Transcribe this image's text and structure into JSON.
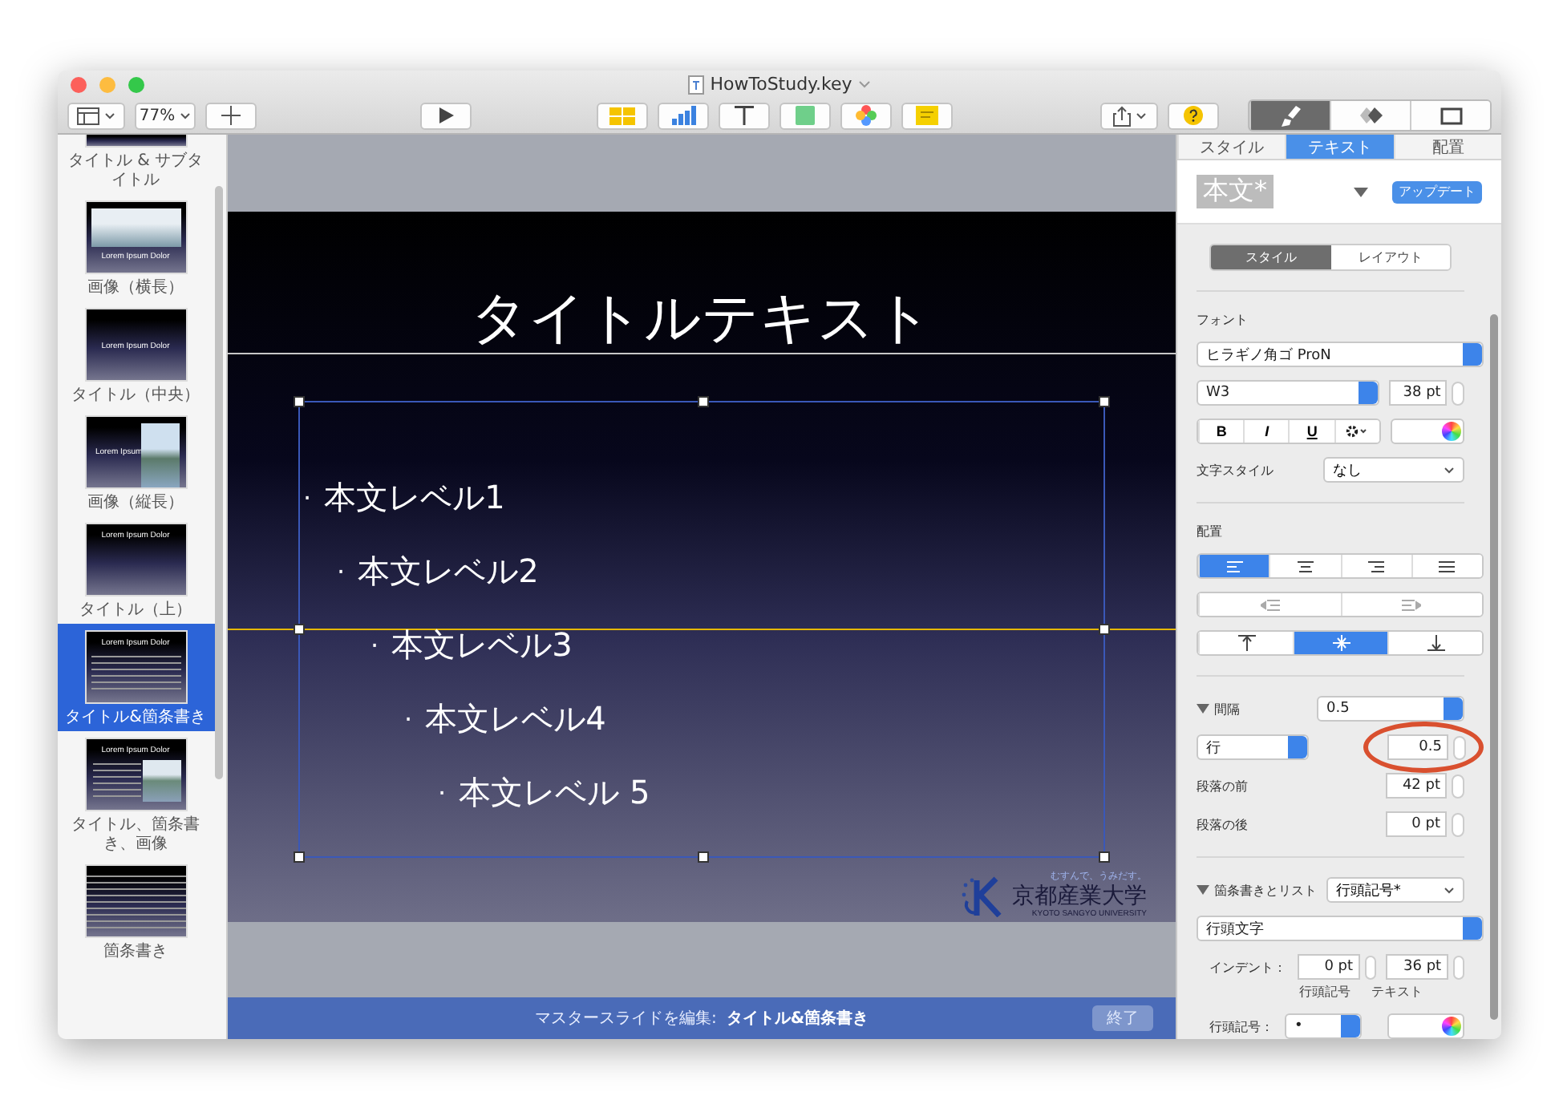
{
  "window": {
    "title": "HowToStudy.key"
  },
  "toolbar": {
    "zoom": "77%"
  },
  "slides": [
    {
      "kind": "title_sub",
      "label": "タイトル & サブタイトル",
      "selected": false
    },
    {
      "kind": "photo_wide",
      "label": "画像（横長）",
      "thumb_title": "Lorem Ipsum Dolor",
      "selected": false
    },
    {
      "kind": "title_center",
      "label": "タイトル（中央）",
      "thumb_title": "Lorem Ipsum Dolor",
      "selected": false
    },
    {
      "kind": "photo_tall",
      "label": "画像（縦長）",
      "thumb_title": "Lorem Ipsum",
      "selected": false
    },
    {
      "kind": "title_top",
      "label": "タイトル（上）",
      "thumb_title": "Lorem Ipsum Dolor",
      "selected": false
    },
    {
      "kind": "bullets",
      "label": "タイトル&箇条書き",
      "thumb_title": "Lorem Ipsum Dolor",
      "selected": true
    },
    {
      "kind": "bullets_photo",
      "label": "タイトル、箇条書き、画像",
      "thumb_title": "Lorem Ipsum Dolor",
      "selected": false
    },
    {
      "kind": "bullets_only",
      "label": "箇条書き",
      "selected": false
    }
  ],
  "slide": {
    "title": "タイトルテキスト",
    "bullet_char": "·",
    "bullets": [
      {
        "text": "本文レベル1",
        "children": [
          {
            "text": "本文レベル2",
            "children": [
              {
                "text": "本文レベル3",
                "children": [
                  {
                    "text": "本文レベル4",
                    "children": [
                      {
                        "text": "本文レベル 5"
                      }
                    ]
                  }
                ]
              }
            ]
          }
        ]
      }
    ],
    "logo": {
      "tagline": "むすんで、うみだす。",
      "name": "京都産業大学",
      "subtitle": "KYOTO SANGYO UNIVERSITY"
    }
  },
  "edit_bar": {
    "label": "マスタースライドを編集:",
    "master": "タイトル&箇条書き",
    "button": "終了"
  },
  "inspector": {
    "tabs": [
      {
        "label": "スタイル",
        "selected": false
      },
      {
        "label": "テキスト",
        "selected": true
      },
      {
        "label": "配置",
        "selected": false
      }
    ],
    "style_name": "本文*",
    "update_button": "アップデート",
    "subtabs": [
      {
        "label": "スタイル",
        "selected": true
      },
      {
        "label": "レイアウト",
        "selected": false
      }
    ],
    "font": {
      "heading": "フォント",
      "family": "ヒラギノ角ゴ ProN",
      "weight": "W3",
      "size": "38 pt",
      "bold": "B",
      "italic": "I",
      "underline": "U",
      "char_style_label": "文字スタイル",
      "char_style": "なし"
    },
    "alignment": {
      "heading": "配置",
      "horizontal": [
        {
          "selected": true
        },
        {
          "selected": false
        },
        {
          "selected": false
        },
        {
          "selected": false
        }
      ],
      "vertical": [
        {
          "selected": false
        },
        {
          "selected": true
        },
        {
          "selected": false
        }
      ]
    },
    "spacing": {
      "heading": "間隔",
      "expanded": true,
      "value": "0.5",
      "mode": "行",
      "line_value": "0.5",
      "before_label": "段落の前",
      "before": "42 pt",
      "after_label": "段落の後",
      "after": "0 pt"
    },
    "bullets": {
      "heading": "箇条書きとリスト",
      "expanded": true,
      "preset": "行頭記号*",
      "type": "行頭文字",
      "indent_label": "インデント：",
      "bullet_indent": "0 pt",
      "text_indent": "36 pt",
      "bullet_caption": "行頭記号",
      "text_caption": "テキスト",
      "bullet_label": "行頭記号：",
      "bullet_char": "•"
    }
  }
}
